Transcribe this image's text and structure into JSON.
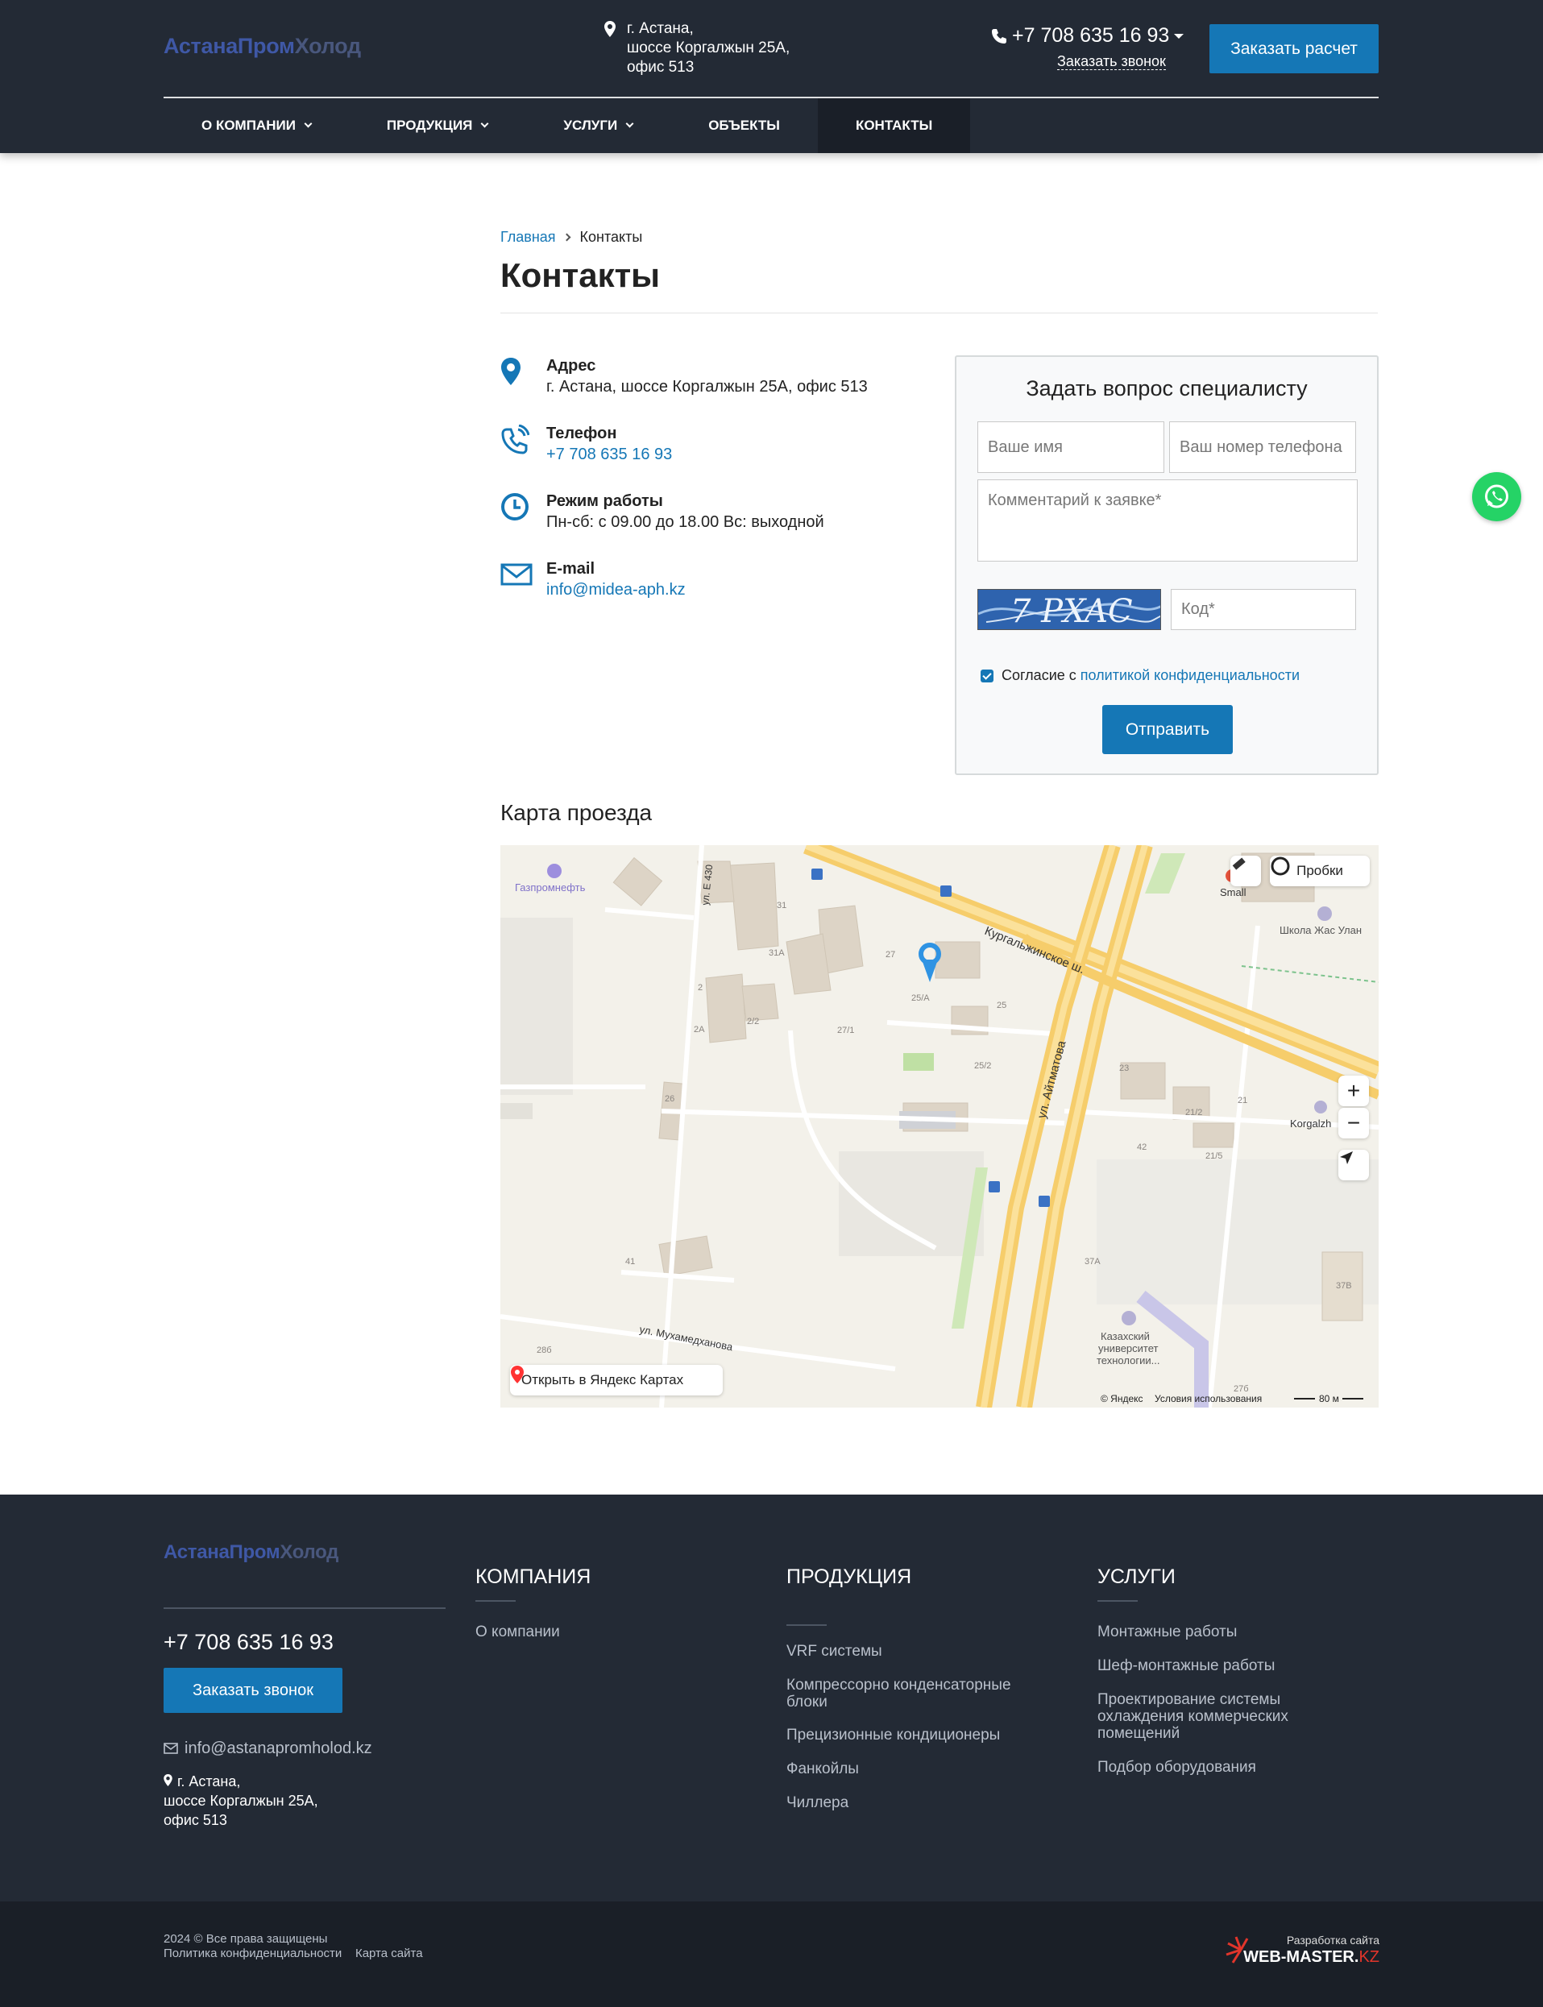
{
  "brand": {
    "logo_part1": "АстанаПром",
    "logo_part2": "Холод"
  },
  "header": {
    "address_lines": [
      "г. Астана,",
      "шоссе Коргалжын 25А,",
      "офис 513"
    ],
    "phone": "+7 708 635 16 93",
    "callback_label": "Заказать звонок",
    "order_label": "Заказать расчет"
  },
  "nav": {
    "items": [
      {
        "label": "О компании",
        "has_dropdown": true,
        "active": false
      },
      {
        "label": "Продукция",
        "has_dropdown": true,
        "active": false
      },
      {
        "label": "Услуги",
        "has_dropdown": true,
        "active": false
      },
      {
        "label": "Объекты",
        "has_dropdown": false,
        "active": false
      },
      {
        "label": "Контакты",
        "has_dropdown": false,
        "active": true
      }
    ]
  },
  "breadcrumb": {
    "home": "Главная",
    "current": "Контакты"
  },
  "page_title": "Контакты",
  "contacts": {
    "address": {
      "label": "Адрес",
      "value": "г. Астана, шоссе Коргалжын 25А, офис 513",
      "icon": "map-pin-icon"
    },
    "phone": {
      "label": "Телефон",
      "value": "+7 708 635 16 93",
      "icon": "phone-icon"
    },
    "hours": {
      "label": "Режим работы",
      "value": "Пн-сб: с 09.00 до 18.00 Вс: выходной",
      "icon": "clock-icon"
    },
    "email": {
      "label": "E-mail",
      "value": "info@midea-aph.kz",
      "icon": "envelope-icon"
    }
  },
  "form": {
    "title": "Задать вопрос специалисту",
    "name_placeholder": "Ваше имя",
    "phone_placeholder": "Ваш номер телефона",
    "comment_placeholder": "Комментарий к заявке*",
    "captcha_text": "7 PXAC",
    "code_placeholder": "Код*",
    "consent_prefix": "Согласие с",
    "consent_link": "политикой конфиденциальности",
    "consent_checked": true,
    "submit_label": "Отправить"
  },
  "map": {
    "title": "Карта проезда",
    "traffic_label": "Пробки",
    "open_label": "Открыть в Яндекс Картах",
    "copyright": "© Яндекс",
    "terms": "Условия использования",
    "scale": "80 м",
    "zoom_in": "+",
    "zoom_out": "−",
    "labels": {
      "gas": "Газпромнефть",
      "street1": "Кургальжинское ш.",
      "street2": "ул. Айтматова",
      "street3": "ул. Мухамедханова",
      "street4": "ул. Е 430",
      "school": "Школа Жас Улан",
      "small": "Small",
      "korgalzh": "Korgalzh",
      "univ1": "Казахский",
      "univ2": "университет",
      "univ3": "технологии...",
      "h31": "31",
      "h31a": "31А",
      "h27": "27",
      "h2": "2",
      "h2a": "2А",
      "h22": "2/2",
      "h271": "27/1",
      "h25a": "25/А",
      "h25": "25",
      "h252": "25/2",
      "h26": "26",
      "h23": "23",
      "h212": "21/2",
      "h21": "21",
      "h42": "42",
      "h215": "21/5",
      "h41": "41",
      "h37a": "37А",
      "h37b": "37В",
      "h28b": "28б",
      "h27b": "27б"
    }
  },
  "footer": {
    "phone": "+7 708 635 16 93",
    "call_label": "Заказать звонок",
    "email": "info@astanapromholod.kz",
    "address_lines": [
      "г. Астана,",
      "шоссе Коргалжын 25А,",
      "офис 513"
    ],
    "columns": [
      {
        "title": "Компания",
        "items": [
          "О компании"
        ]
      },
      {
        "title": "Продукция",
        "items": [
          "VRF системы",
          "Компрессорно конденсаторные блоки",
          "Прецизионные кондиционеры",
          "Фанкойлы",
          "Чиллера"
        ]
      },
      {
        "title": "Услуги",
        "items": [
          "Монтажные работы",
          "Шеф-монтажные работы",
          "Проектирование системы охлаждения коммерческих помещений",
          "Подбор оборудования"
        ]
      }
    ]
  },
  "bottom": {
    "copyright": "2024 © Все права защищены",
    "privacy": "Политика конфиденциальности",
    "sitemap": "Карта сайта",
    "dev_label": "Разработка сайта",
    "dev_name": "WEB-MASTER.",
    "dev_tld": "KZ"
  },
  "colors": {
    "accent": "#1577b6",
    "header_bg": "#232a35",
    "whatsapp": "#25d366"
  }
}
